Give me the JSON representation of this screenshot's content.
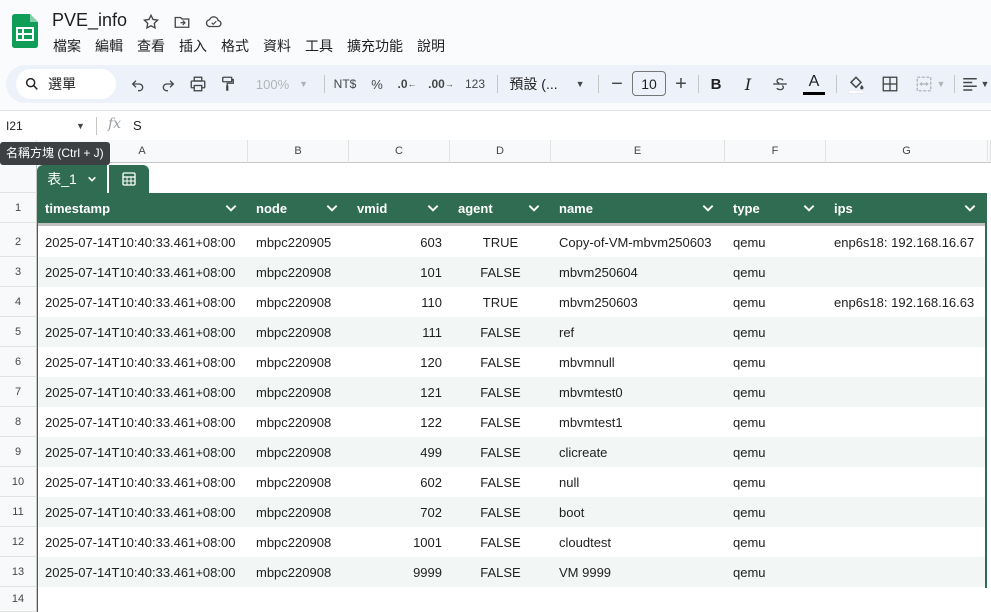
{
  "app": {
    "doc_title": "PVE_info",
    "menu": [
      "檔案",
      "編輯",
      "查看",
      "插入",
      "格式",
      "資料",
      "工具",
      "擴充功能",
      "說明"
    ]
  },
  "toolbar": {
    "search_label": "選單",
    "zoom": "100%",
    "currency": "NT$",
    "percent": "%",
    "dec_decrease": ".0",
    "dec_increase": ".00",
    "number_format": "123",
    "font": "預設 (...",
    "font_size": "10",
    "bold": "B",
    "italic": "I",
    "text_color_letter": "A"
  },
  "formula_bar": {
    "name_box": "I21",
    "fx": "fx",
    "value": "S"
  },
  "tooltip": "名稱方塊 (Ctrl + J)",
  "columns": [
    "A",
    "B",
    "C",
    "D",
    "E",
    "F",
    "G"
  ],
  "rows": [
    "1",
    "2",
    "3",
    "4",
    "5",
    "6",
    "7",
    "8",
    "9",
    "10",
    "11",
    "12",
    "13",
    "14"
  ],
  "table": {
    "tab_name": "表_1",
    "headers": [
      "timestamp",
      "node",
      "vmid",
      "agent",
      "name",
      "type",
      "ips"
    ],
    "data": [
      [
        "2025-07-14T10:40:33.461+08:00",
        "mbpc220905",
        "603",
        "TRUE",
        "Copy-of-VM-mbvm250603",
        "qemu",
        "enp6s18: 192.168.16.67"
      ],
      [
        "2025-07-14T10:40:33.461+08:00",
        "mbpc220908",
        "101",
        "FALSE",
        "mbvm250604",
        "qemu",
        ""
      ],
      [
        "2025-07-14T10:40:33.461+08:00",
        "mbpc220908",
        "110",
        "TRUE",
        "mbvm250603",
        "qemu",
        "enp6s18: 192.168.16.63"
      ],
      [
        "2025-07-14T10:40:33.461+08:00",
        "mbpc220908",
        "111",
        "FALSE",
        "ref",
        "qemu",
        ""
      ],
      [
        "2025-07-14T10:40:33.461+08:00",
        "mbpc220908",
        "120",
        "FALSE",
        "mbvmnull",
        "qemu",
        ""
      ],
      [
        "2025-07-14T10:40:33.461+08:00",
        "mbpc220908",
        "121",
        "FALSE",
        "mbvmtest0",
        "qemu",
        ""
      ],
      [
        "2025-07-14T10:40:33.461+08:00",
        "mbpc220908",
        "122",
        "FALSE",
        "mbvmtest1",
        "qemu",
        ""
      ],
      [
        "2025-07-14T10:40:33.461+08:00",
        "mbpc220908",
        "499",
        "FALSE",
        "clicreate",
        "qemu",
        ""
      ],
      [
        "2025-07-14T10:40:33.461+08:00",
        "mbpc220908",
        "602",
        "FALSE",
        "null",
        "qemu",
        ""
      ],
      [
        "2025-07-14T10:40:33.461+08:00",
        "mbpc220908",
        "702",
        "FALSE",
        "boot",
        "qemu",
        ""
      ],
      [
        "2025-07-14T10:40:33.461+08:00",
        "mbpc220908",
        "1001",
        "FALSE",
        "cloudtest",
        "qemu",
        ""
      ],
      [
        "2025-07-14T10:40:33.461+08:00",
        "mbpc220908",
        "9999",
        "FALSE",
        "VM 9999",
        "qemu",
        ""
      ]
    ]
  },
  "colors": {
    "table_header": "#2f6c52",
    "band": "#f2f6f4"
  }
}
